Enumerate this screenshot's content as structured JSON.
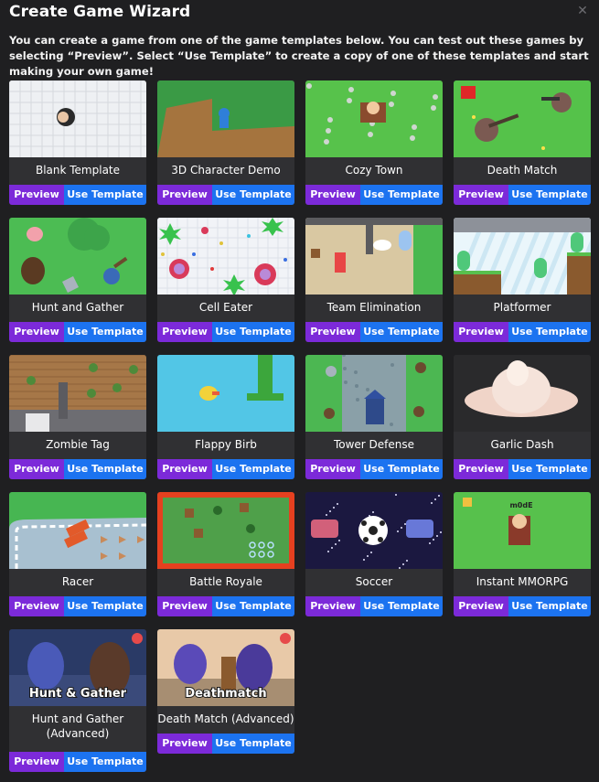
{
  "window": {
    "title": "Create Game Wizard",
    "close_icon": "close-icon",
    "intro": "You can create a game from one of the game templates below. You can test out these games by selecting “Preview”. Select “Use Template” to create a copy of one of these templates and start making your own game!"
  },
  "buttons": {
    "preview": "Preview",
    "use_template": "Use Template"
  },
  "colors": {
    "preview": "#7c2ad9",
    "use_template": "#1c73f0",
    "background": "#1f1f21",
    "card": "#303033"
  },
  "templates": [
    {
      "name": "Blank Template"
    },
    {
      "name": "3D Character Demo"
    },
    {
      "name": "Cozy Town"
    },
    {
      "name": "Death Match"
    },
    {
      "name": "Hunt and Gather"
    },
    {
      "name": "Cell Eater"
    },
    {
      "name": "Team Elimination"
    },
    {
      "name": "Platformer"
    },
    {
      "name": "Zombie Tag"
    },
    {
      "name": "Flappy Birb"
    },
    {
      "name": "Tower Defense"
    },
    {
      "name": "Garlic Dash"
    },
    {
      "name": "Racer"
    },
    {
      "name": "Battle Royale"
    },
    {
      "name": "Soccer"
    },
    {
      "name": "Instant MMORPG",
      "thumb_text": "m0dE"
    },
    {
      "name": "Hunt and Gather (Advanced)",
      "thumb_text": "Hunt & Gather"
    },
    {
      "name": "Death Match (Advanced)",
      "thumb_text": "Deathmatch"
    }
  ]
}
